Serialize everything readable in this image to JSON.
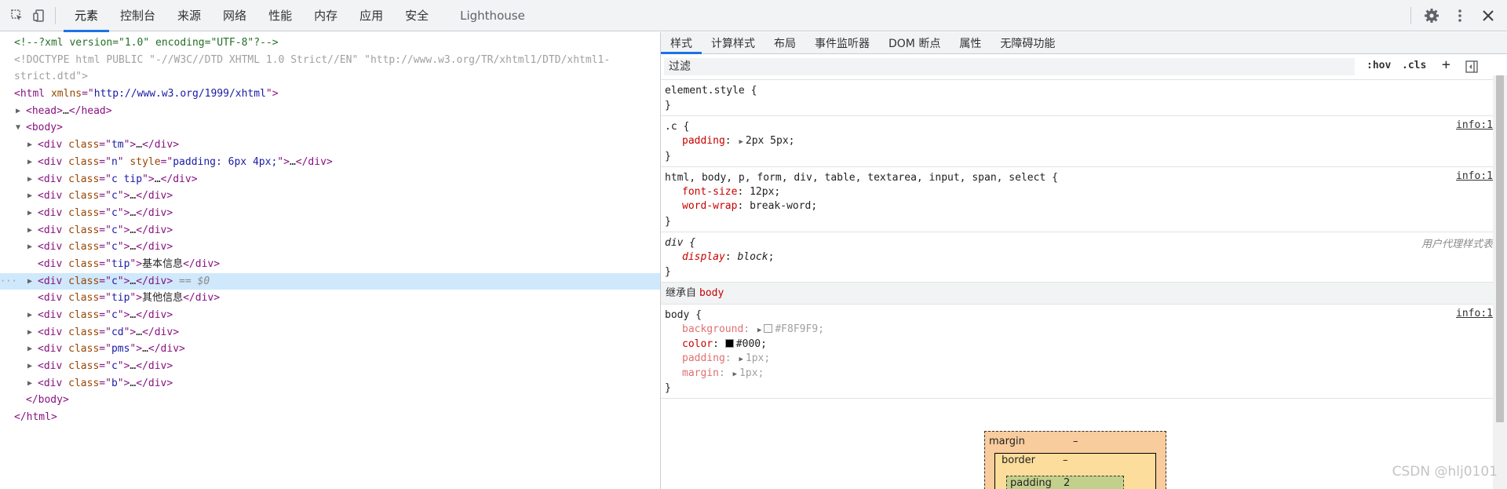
{
  "toolbar": {
    "tabs": [
      "元素",
      "控制台",
      "来源",
      "网络",
      "性能",
      "内存",
      "应用",
      "安全"
    ],
    "lighthouse": "Lighthouse",
    "icons": [
      "inspect-element-icon",
      "device-toolbar-icon",
      "settings-gear-icon",
      "more-vertical-icon",
      "close-icon"
    ]
  },
  "dom": {
    "lines": [
      {
        "indent": 0,
        "arrow": "",
        "parts": [
          [
            "comment",
            "<!--?xml version=\"1.0\" encoding=\"UTF-8\"?-->"
          ]
        ]
      },
      {
        "indent": 0,
        "arrow": "",
        "parts": [
          [
            "doctype",
            "<!DOCTYPE html PUBLIC \"-//W3C//DTD XHTML 1.0 Strict//EN\" \"http://www.w3.org/TR/xhtml1/DTD/xhtml1-"
          ]
        ]
      },
      {
        "indent": 0,
        "arrow": "",
        "parts": [
          [
            "doctype",
            "strict.dtd\">"
          ]
        ]
      },
      {
        "indent": 0,
        "arrow": "",
        "parts": [
          [
            "tag",
            "<html "
          ],
          [
            "attr",
            "xmlns"
          ],
          [
            "tag",
            "=\""
          ],
          [
            "val",
            "http://www.w3.org/1999/xhtml"
          ],
          [
            "tag",
            "\">"
          ]
        ]
      },
      {
        "indent": 1,
        "arrow": "▶",
        "parts": [
          [
            "tag",
            "<head>"
          ],
          [
            "text",
            "…"
          ],
          [
            "tag",
            "</head>"
          ]
        ]
      },
      {
        "indent": 1,
        "arrow": "▼",
        "parts": [
          [
            "tag",
            "<body>"
          ]
        ]
      },
      {
        "indent": 2,
        "arrow": "▶",
        "parts": [
          [
            "tag",
            "<div "
          ],
          [
            "attr",
            "class"
          ],
          [
            "tag",
            "=\""
          ],
          [
            "val",
            "tm"
          ],
          [
            "tag",
            "\">"
          ],
          [
            "text",
            "…"
          ],
          [
            "tag",
            "</div>"
          ]
        ]
      },
      {
        "indent": 2,
        "arrow": "▶",
        "parts": [
          [
            "tag",
            "<div "
          ],
          [
            "attr",
            "class"
          ],
          [
            "tag",
            "=\""
          ],
          [
            "val",
            "n"
          ],
          [
            "tag",
            "\" "
          ],
          [
            "attr",
            "style"
          ],
          [
            "tag",
            "=\""
          ],
          [
            "val",
            "padding: 6px 4px;"
          ],
          [
            "tag",
            "\">"
          ],
          [
            "text",
            "…"
          ],
          [
            "tag",
            "</div>"
          ]
        ]
      },
      {
        "indent": 2,
        "arrow": "▶",
        "parts": [
          [
            "tag",
            "<div "
          ],
          [
            "attr",
            "class"
          ],
          [
            "tag",
            "=\""
          ],
          [
            "val",
            "c tip"
          ],
          [
            "tag",
            "\">"
          ],
          [
            "text",
            "…"
          ],
          [
            "tag",
            "</div>"
          ]
        ]
      },
      {
        "indent": 2,
        "arrow": "▶",
        "parts": [
          [
            "tag",
            "<div "
          ],
          [
            "attr",
            "class"
          ],
          [
            "tag",
            "=\""
          ],
          [
            "val",
            "c"
          ],
          [
            "tag",
            "\">"
          ],
          [
            "text",
            "…"
          ],
          [
            "tag",
            "</div>"
          ]
        ]
      },
      {
        "indent": 2,
        "arrow": "▶",
        "parts": [
          [
            "tag",
            "<div "
          ],
          [
            "attr",
            "class"
          ],
          [
            "tag",
            "=\""
          ],
          [
            "val",
            "c"
          ],
          [
            "tag",
            "\">"
          ],
          [
            "text",
            "…"
          ],
          [
            "tag",
            "</div>"
          ]
        ]
      },
      {
        "indent": 2,
        "arrow": "▶",
        "parts": [
          [
            "tag",
            "<div "
          ],
          [
            "attr",
            "class"
          ],
          [
            "tag",
            "=\""
          ],
          [
            "val",
            "c"
          ],
          [
            "tag",
            "\">"
          ],
          [
            "text",
            "…"
          ],
          [
            "tag",
            "</div>"
          ]
        ]
      },
      {
        "indent": 2,
        "arrow": "▶",
        "parts": [
          [
            "tag",
            "<div "
          ],
          [
            "attr",
            "class"
          ],
          [
            "tag",
            "=\""
          ],
          [
            "val",
            "c"
          ],
          [
            "tag",
            "\">"
          ],
          [
            "text",
            "…"
          ],
          [
            "tag",
            "</div>"
          ]
        ]
      },
      {
        "indent": 2,
        "arrow": "",
        "parts": [
          [
            "tag",
            "<div "
          ],
          [
            "attr",
            "class"
          ],
          [
            "tag",
            "=\""
          ],
          [
            "val",
            "tip"
          ],
          [
            "tag",
            "\">"
          ],
          [
            "text",
            "基本信息"
          ],
          [
            "tag",
            "</div>"
          ]
        ]
      },
      {
        "indent": 2,
        "arrow": "▶",
        "selected": true,
        "parts": [
          [
            "tag",
            "<div "
          ],
          [
            "attr",
            "class"
          ],
          [
            "tag",
            "=\""
          ],
          [
            "val",
            "c"
          ],
          [
            "tag",
            "\">"
          ],
          [
            "text",
            "…"
          ],
          [
            "tag",
            "</div>"
          ],
          [
            "eq",
            " == $0"
          ]
        ]
      },
      {
        "indent": 2,
        "arrow": "",
        "parts": [
          [
            "tag",
            "<div "
          ],
          [
            "attr",
            "class"
          ],
          [
            "tag",
            "=\""
          ],
          [
            "val",
            "tip"
          ],
          [
            "tag",
            "\">"
          ],
          [
            "text",
            "其他信息"
          ],
          [
            "tag",
            "</div>"
          ]
        ]
      },
      {
        "indent": 2,
        "arrow": "▶",
        "parts": [
          [
            "tag",
            "<div "
          ],
          [
            "attr",
            "class"
          ],
          [
            "tag",
            "=\""
          ],
          [
            "val",
            "c"
          ],
          [
            "tag",
            "\">"
          ],
          [
            "text",
            "…"
          ],
          [
            "tag",
            "</div>"
          ]
        ]
      },
      {
        "indent": 2,
        "arrow": "▶",
        "parts": [
          [
            "tag",
            "<div "
          ],
          [
            "attr",
            "class"
          ],
          [
            "tag",
            "=\""
          ],
          [
            "val",
            "cd"
          ],
          [
            "tag",
            "\">"
          ],
          [
            "text",
            "…"
          ],
          [
            "tag",
            "</div>"
          ]
        ]
      },
      {
        "indent": 2,
        "arrow": "▶",
        "parts": [
          [
            "tag",
            "<div "
          ],
          [
            "attr",
            "class"
          ],
          [
            "tag",
            "=\""
          ],
          [
            "val",
            "pms"
          ],
          [
            "tag",
            "\">"
          ],
          [
            "text",
            "…"
          ],
          [
            "tag",
            "</div>"
          ]
        ]
      },
      {
        "indent": 2,
        "arrow": "▶",
        "parts": [
          [
            "tag",
            "<div "
          ],
          [
            "attr",
            "class"
          ],
          [
            "tag",
            "=\""
          ],
          [
            "val",
            "c"
          ],
          [
            "tag",
            "\">"
          ],
          [
            "text",
            "…"
          ],
          [
            "tag",
            "</div>"
          ]
        ]
      },
      {
        "indent": 2,
        "arrow": "▶",
        "parts": [
          [
            "tag",
            "<div "
          ],
          [
            "attr",
            "class"
          ],
          [
            "tag",
            "=\""
          ],
          [
            "val",
            "b"
          ],
          [
            "tag",
            "\">"
          ],
          [
            "text",
            "…"
          ],
          [
            "tag",
            "</div>"
          ]
        ]
      },
      {
        "indent": 1,
        "arrow": "",
        "parts": [
          [
            "tag",
            "</body>"
          ]
        ]
      },
      {
        "indent": 0,
        "arrow": "",
        "parts": [
          [
            "tag",
            "</html>"
          ]
        ]
      }
    ],
    "selected_marker": "···"
  },
  "styles": {
    "sub_tabs": [
      "样式",
      "计算样式",
      "布局",
      "事件监听器",
      "DOM 断点",
      "属性",
      "无障碍功能"
    ],
    "filter_placeholder": "过滤",
    "hov": ":hov",
    "cls": ".cls",
    "plus": "+",
    "element_style": "element.style {",
    "close_brace": "}",
    "rules": [
      {
        "selector": ".c {",
        "source": "info:1",
        "props": [
          {
            "name": "padding",
            "value": "2px 5px",
            "arrow": true
          }
        ]
      },
      {
        "selector": "html, body, p, form, div, table, textarea, input, span, select {",
        "source": "info:1",
        "props": [
          {
            "name": "font-size",
            "value": "12px"
          },
          {
            "name": "word-wrap",
            "value": "break-word"
          }
        ]
      },
      {
        "selector": "div {",
        "source": "用户代理样式表",
        "ua": true,
        "props": [
          {
            "name": "display",
            "value": "block"
          }
        ]
      }
    ],
    "inherited_label": "继承自",
    "inherited_tag": "body",
    "body_rule": {
      "selector": "body {",
      "source": "info:1",
      "props": [
        {
          "name": "background",
          "value": "#F8F9F9",
          "inactive": true,
          "arrow": true,
          "swatch": "#F8F9F9"
        },
        {
          "name": "color",
          "value": "#000",
          "swatch": "#000000"
        },
        {
          "name": "padding",
          "value": "1px",
          "inactive": true,
          "arrow": true
        },
        {
          "name": "margin",
          "value": "1px",
          "inactive": true,
          "arrow": true
        }
      ]
    },
    "box_model": {
      "margin_label": "margin",
      "margin_value": "–",
      "border_label": "border",
      "border_value": "–",
      "padding_label": "padding",
      "padding_value": "2"
    }
  },
  "colors": {
    "accent": "#1a73e8",
    "selected_row": "#cfe8fc",
    "margin_box": "#f9cc9d",
    "border_box": "#fddd9b",
    "padding_box": "#c3d08b"
  },
  "watermark": "CSDN @hlj0101"
}
